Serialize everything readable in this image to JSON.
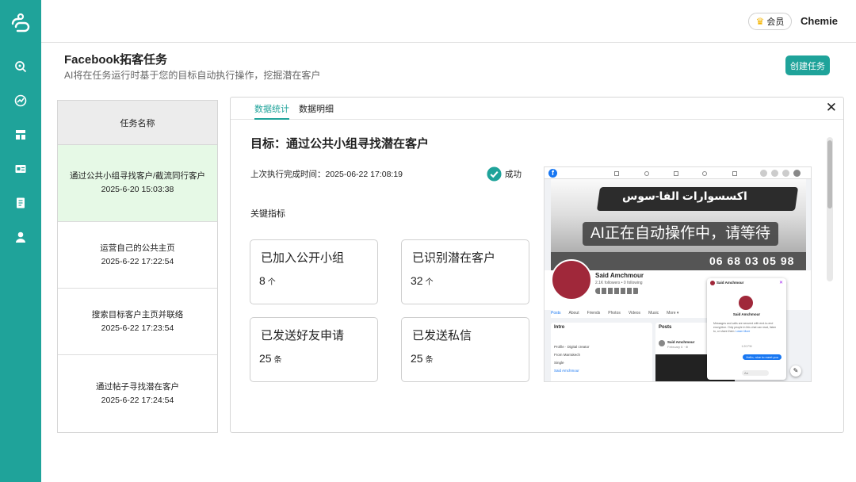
{
  "sidebar": {
    "items": [
      {
        "icon": "search-zoom-icon"
      },
      {
        "icon": "trend-icon"
      },
      {
        "icon": "layout-icon"
      },
      {
        "icon": "id-card-icon"
      },
      {
        "icon": "book-icon"
      },
      {
        "icon": "user-icon"
      }
    ]
  },
  "header": {
    "member_label": "会员",
    "username": "Chemie"
  },
  "page": {
    "title": "Facebook拓客任务",
    "subtitle": "AI将在任务运行时基于您的目标自动执行操作，挖掘潜在客户",
    "create_button": "创建任务"
  },
  "task_list": {
    "header": "任务名称",
    "rows": [
      {
        "name": "通过公共小组寻找客户/截流同行客户",
        "time": "2025-6-20 15:03:38"
      },
      {
        "name": "运营自己的公共主页",
        "time": "2025-6-22 17:22:54"
      },
      {
        "name": "搜索目标客户主页并联络",
        "time": "2025-6-22 17:23:54"
      },
      {
        "name": "通过帖子寻找潜在客户",
        "time": "2025-6-22 17:24:54"
      }
    ]
  },
  "detail": {
    "tabs": [
      "数据统计",
      "数据明细"
    ],
    "goal": "目标：通过公共小组寻找潜在客户",
    "last_run": "上次执行完成时间：2025-06-22 17:08:19",
    "status": "成功",
    "kpi_title": "关键指标",
    "kpis": [
      {
        "label": "已加入公开小组",
        "value": "8",
        "unit": "个"
      },
      {
        "label": "已识别潜在客户",
        "value": "32",
        "unit": "个"
      },
      {
        "label": "已发送好友申请",
        "value": "25",
        "unit": "条"
      },
      {
        "label": "已发送私信",
        "value": "25",
        "unit": "条"
      }
    ],
    "screenshot": {
      "overlay": "AI正在自动操作中，请等待",
      "banner_text": "اكسسوارات الفا-سوس",
      "phone": "06 68 03 05 98",
      "profile_name": "Said Amchmour",
      "profile_meta": "2.1K followers • 0 following",
      "tabs": [
        "Posts",
        "About",
        "Friends",
        "Photos",
        "Videos",
        "Music",
        "More ▾"
      ],
      "intro": "Intro",
      "intro_lines": [
        "Profile · Digital creator",
        "From Marrakech",
        "Single",
        "Said Amchmour"
      ],
      "posts": "Posts",
      "post_author": "Said Amchmour",
      "post_date": "February 6 · ⊕",
      "chat_name": "Said Amchmour",
      "chat_notice": "Messages and calls are secured with end-to-end encryption. Only people in this chat can read, listen to, or share them.",
      "chat_learn": "Learn More",
      "chat_time": "1:20 PM",
      "chat_bubble": "Hello, nice to meet you",
      "chat_input": "Aa"
    }
  },
  "colors": {
    "accent": "#1fa39a",
    "active_row": "#e6f9e6",
    "facebook": "#1877f2"
  }
}
